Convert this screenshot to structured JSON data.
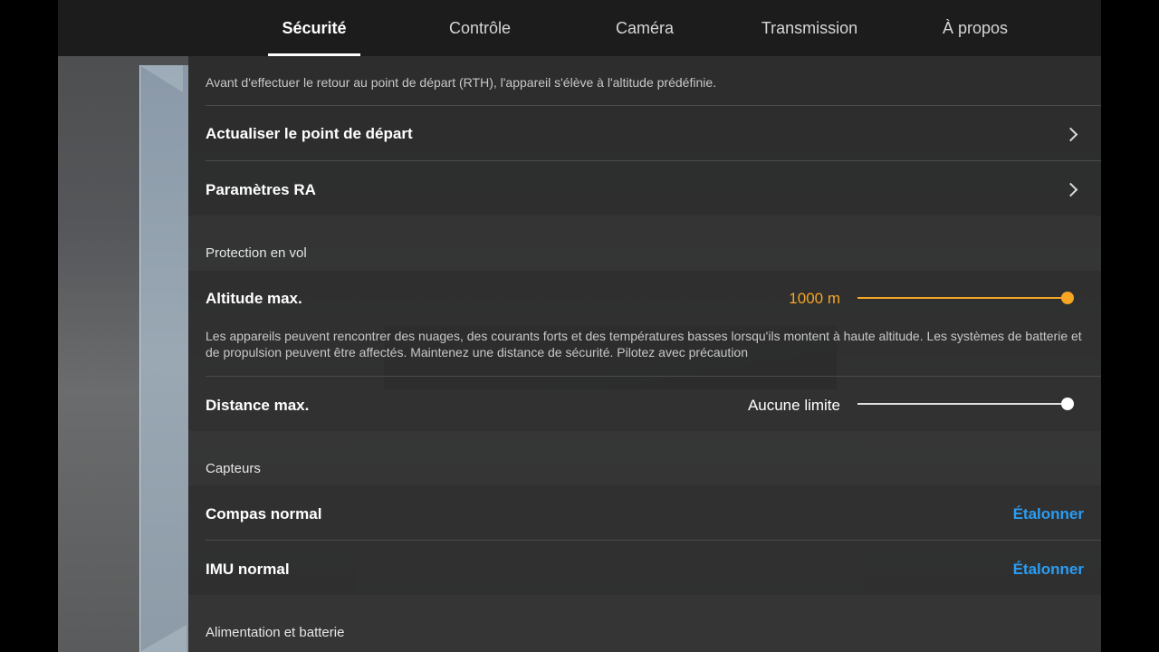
{
  "tabs": [
    {
      "label": "Sécurité"
    },
    {
      "label": "Contrôle"
    },
    {
      "label": "Caméra"
    },
    {
      "label": "Transmission"
    },
    {
      "label": "À propos"
    }
  ],
  "active_tab": "Sécurité",
  "rth": {
    "description": "Avant d'effectuer le retour au point de départ (RTH), l'appareil s'élève à l'altitude prédéfinie.",
    "update_home_label": "Actualiser le point de départ",
    "ar_settings_label": "Paramètres RA"
  },
  "flight_protection": {
    "section_label": "Protection en vol",
    "max_altitude": {
      "label": "Altitude max.",
      "value": "1000 m",
      "slider_level": 1.0,
      "accent_color": "#f5a623"
    },
    "altitude_warning": "Les appareils peuvent rencontrer des nuages, des courants forts et des températures basses lorsqu'ils montent à haute altitude. Les systèmes de batterie et de propulsion peuvent être affectés. Maintenez une distance de sécurité. Pilotez avec précaution",
    "max_distance": {
      "label": "Distance max.",
      "value": "Aucune limite",
      "slider_level": 1.0
    }
  },
  "sensors": {
    "section_label": "Capteurs",
    "compass": {
      "label": "Compas normal",
      "action": "Étalonner"
    },
    "imu": {
      "label": "IMU normal",
      "action": "Étalonner"
    }
  },
  "power": {
    "section_label": "Alimentation et batterie"
  },
  "colors": {
    "accent_orange": "#f5a623",
    "link_blue": "#2a9df4"
  }
}
